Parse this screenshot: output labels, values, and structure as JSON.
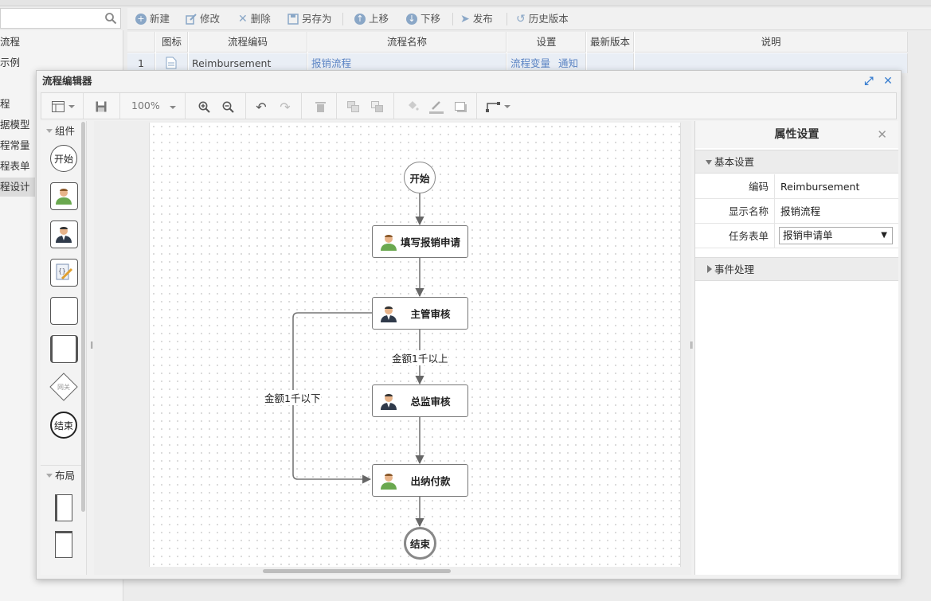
{
  "background": {
    "left_nav": [
      {
        "label": "流程",
        "active": false
      },
      {
        "label": "示例",
        "active": false
      },
      {
        "label": "程",
        "active": false
      },
      {
        "label": "据模型",
        "active": false
      },
      {
        "label": "程常量",
        "active": false
      },
      {
        "label": "程表单",
        "active": false
      },
      {
        "label": "程设计",
        "active": true
      }
    ],
    "toolbar": {
      "new": "新建",
      "edit": "修改",
      "delete": "删除",
      "save_as": "另存为",
      "move_up": "上移",
      "move_down": "下移",
      "publish": "发布",
      "history": "历史版本"
    },
    "grid": {
      "headers": [
        "图标",
        "流程编码",
        "流程名称",
        "设置",
        "最新版本",
        "说明"
      ],
      "row": {
        "index": "1",
        "code": "Reimbursement",
        "name": "报销流程",
        "settings_links": [
          "流程变量",
          "通知"
        ],
        "version": "",
        "description": ""
      }
    }
  },
  "editor": {
    "title": "流程编辑器",
    "zoom": "100%",
    "palette": {
      "components_header": "组件",
      "start_label": "开始",
      "gateway_label": "网关",
      "end_label": "结束",
      "layout_header": "布局"
    },
    "flow": {
      "start": "开始",
      "step1": "填写报销申请",
      "step2": "主管审核",
      "step3": "总监审核",
      "step4": "出纳付款",
      "end": "结束",
      "edge_over_1k": "金额1千以上",
      "edge_under_1k": "金额1千以下"
    },
    "properties": {
      "title": "属性设置",
      "basic_section": "基本设置",
      "code_label": "编码",
      "code_value": "Reimbursement",
      "display_name_label": "显示名称",
      "display_name_value": "报销流程",
      "task_form_label": "任务表单",
      "task_form_value": "报销申请单",
      "events_section": "事件处理"
    }
  },
  "colors": {
    "accent_blue": "#3b7fd0",
    "link_blue": "#5b84c4",
    "person_green": "#6aa84f"
  }
}
